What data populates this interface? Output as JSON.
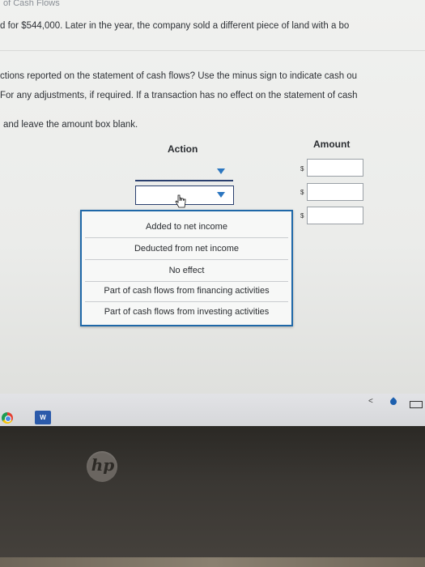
{
  "header": {
    "title": "of Cash Flows"
  },
  "body_text": {
    "line1": "d for $544,000. Later in the year, the company sold a different piece of land with a bo",
    "line2": "ctions reported on the statement of cash flows? Use the minus sign to indicate cash ou",
    "line3": "For any adjustments, if required. If a transaction has no effect on the statement of cash",
    "line4": "and leave the amount box blank."
  },
  "table": {
    "action_header": "Action",
    "amount_header": "Amount",
    "currency": "$",
    "rows": [
      {
        "action": "",
        "amount": ""
      },
      {
        "action": "",
        "amount": ""
      },
      {
        "action": "",
        "amount": ""
      }
    ]
  },
  "dropdown": {
    "options": [
      "Added to net income",
      "Deducted from net income",
      "No effect",
      "Part of cash flows from financing activities",
      "Part of cash flows from investing activities"
    ]
  },
  "taskbar": {
    "chrome_icon": "chrome-icon",
    "word_icon_label": "W",
    "tray_chevron": "<"
  },
  "laptop": {
    "logo_text": "hp"
  }
}
